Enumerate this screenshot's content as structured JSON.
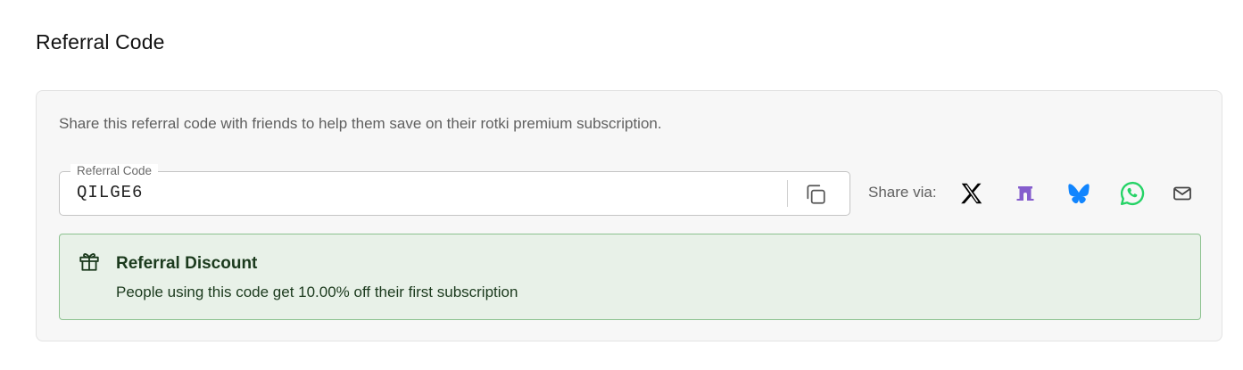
{
  "page": {
    "title": "Referral Code"
  },
  "card": {
    "description": "Share this referral code with friends to help them save on their rotki premium subscription."
  },
  "referral_field": {
    "label": "Referral Code",
    "value": "QILGE6"
  },
  "share": {
    "label": "Share via:",
    "targets": [
      {
        "name": "X",
        "icon": "x-icon",
        "color": "#000000"
      },
      {
        "name": "Farcaster",
        "icon": "farcaster-icon",
        "color": "#855dcd"
      },
      {
        "name": "Bluesky",
        "icon": "bluesky-icon",
        "color": "#1185fe"
      },
      {
        "name": "WhatsApp",
        "icon": "whatsapp-icon",
        "color": "#25d366"
      },
      {
        "name": "Email",
        "icon": "email-icon",
        "color": "#444444"
      }
    ]
  },
  "discount_alert": {
    "title": "Referral Discount",
    "text": "People using this code get 10.00% off their first subscription",
    "icon": "gift-icon",
    "colors": {
      "background": "#e8f1e8",
      "border": "#8cc28f",
      "text": "#1b3a1d"
    }
  }
}
